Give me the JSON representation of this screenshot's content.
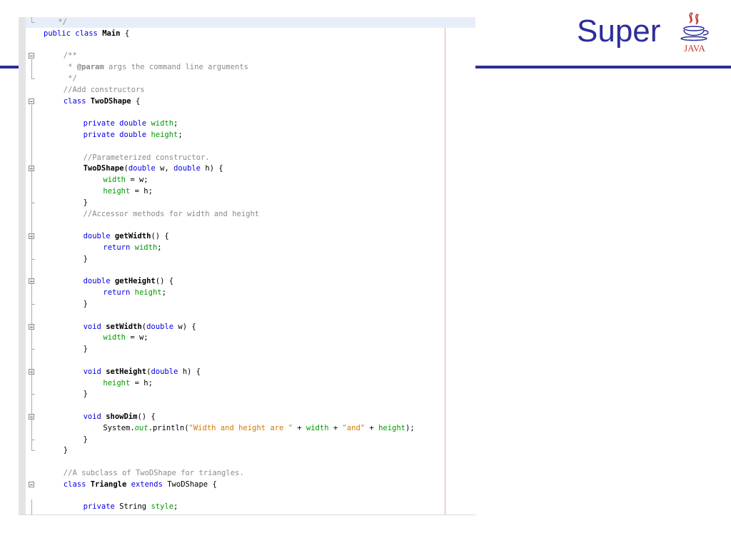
{
  "slide": {
    "title": "Super",
    "logo_text": "JAVA",
    "accent_color": "#2b2e9c"
  },
  "editor": {
    "colors": {
      "keyword": "#0000e6",
      "comment": "#8a8a8a",
      "field": "#009900",
      "string": "#ce7b00"
    },
    "lines": [
      {
        "indent": 2,
        "fold": "corner",
        "highlight": true,
        "tokens": [
          {
            "t": " */",
            "c": "cm"
          }
        ]
      },
      {
        "indent": 0,
        "tokens": [
          {
            "t": "public ",
            "c": "kw"
          },
          {
            "t": "class ",
            "c": "kw"
          },
          {
            "t": "Main",
            "c": "bd"
          },
          {
            "t": " {",
            "c": "pl"
          }
        ]
      },
      {
        "indent": 0,
        "tokens": []
      },
      {
        "indent": 4,
        "fold": "box",
        "tokens": [
          {
            "t": "/**",
            "c": "cm"
          }
        ]
      },
      {
        "indent": 4,
        "tokens": [
          {
            "t": " * ",
            "c": "cm"
          },
          {
            "t": "@param",
            "c": "cmb"
          },
          {
            "t": " args the command line arguments",
            "c": "cm"
          }
        ]
      },
      {
        "indent": 4,
        "fold": "corner",
        "tokens": [
          {
            "t": " */",
            "c": "cm"
          }
        ]
      },
      {
        "indent": 4,
        "tokens": [
          {
            "t": "//Add constructors",
            "c": "cm"
          }
        ]
      },
      {
        "indent": 4,
        "fold": "box",
        "tokens": [
          {
            "t": "class ",
            "c": "kw"
          },
          {
            "t": "TwoDShape",
            "c": "bd"
          },
          {
            "t": " {",
            "c": "pl"
          }
        ]
      },
      {
        "indent": 0,
        "tokens": []
      },
      {
        "indent": 8,
        "tokens": [
          {
            "t": "private ",
            "c": "kw"
          },
          {
            "t": "double ",
            "c": "kw"
          },
          {
            "t": "width",
            "c": "fd"
          },
          {
            "t": ";",
            "c": "pl"
          }
        ]
      },
      {
        "indent": 8,
        "tokens": [
          {
            "t": "private ",
            "c": "kw"
          },
          {
            "t": "double ",
            "c": "kw"
          },
          {
            "t": "height",
            "c": "fd"
          },
          {
            "t": ";",
            "c": "pl"
          }
        ]
      },
      {
        "indent": 0,
        "tokens": []
      },
      {
        "indent": 8,
        "tokens": [
          {
            "t": "//Parameterized constructor.",
            "c": "cm"
          }
        ]
      },
      {
        "indent": 8,
        "fold": "box",
        "tokens": [
          {
            "t": "TwoDShape",
            "c": "bd"
          },
          {
            "t": "(",
            "c": "pl"
          },
          {
            "t": "double",
            "c": "kw"
          },
          {
            "t": " w, ",
            "c": "pl"
          },
          {
            "t": "double",
            "c": "kw"
          },
          {
            "t": " h) {",
            "c": "pl"
          }
        ]
      },
      {
        "indent": 12,
        "tokens": [
          {
            "t": "width",
            "c": "fd"
          },
          {
            "t": " = w;",
            "c": "pl"
          }
        ]
      },
      {
        "indent": 12,
        "tokens": [
          {
            "t": "height",
            "c": "fd"
          },
          {
            "t": " = h;",
            "c": "pl"
          }
        ]
      },
      {
        "indent": 8,
        "fold": "tick",
        "tokens": [
          {
            "t": "}",
            "c": "pl"
          }
        ]
      },
      {
        "indent": 8,
        "tokens": [
          {
            "t": "//Accessor methods for width and height",
            "c": "cm"
          }
        ]
      },
      {
        "indent": 0,
        "tokens": []
      },
      {
        "indent": 8,
        "fold": "box",
        "tokens": [
          {
            "t": "double ",
            "c": "kw"
          },
          {
            "t": "getWidth",
            "c": "bd"
          },
          {
            "t": "() {",
            "c": "pl"
          }
        ]
      },
      {
        "indent": 12,
        "tokens": [
          {
            "t": "return ",
            "c": "kw"
          },
          {
            "t": "width",
            "c": "fd"
          },
          {
            "t": ";",
            "c": "pl"
          }
        ]
      },
      {
        "indent": 8,
        "fold": "tick",
        "tokens": [
          {
            "t": "}",
            "c": "pl"
          }
        ]
      },
      {
        "indent": 0,
        "tokens": []
      },
      {
        "indent": 8,
        "fold": "box",
        "tokens": [
          {
            "t": "double ",
            "c": "kw"
          },
          {
            "t": "getHeight",
            "c": "bd"
          },
          {
            "t": "() {",
            "c": "pl"
          }
        ]
      },
      {
        "indent": 12,
        "tokens": [
          {
            "t": "return ",
            "c": "kw"
          },
          {
            "t": "height",
            "c": "fd"
          },
          {
            "t": ";",
            "c": "pl"
          }
        ]
      },
      {
        "indent": 8,
        "fold": "tick",
        "tokens": [
          {
            "t": "}",
            "c": "pl"
          }
        ]
      },
      {
        "indent": 0,
        "tokens": []
      },
      {
        "indent": 8,
        "fold": "box",
        "tokens": [
          {
            "t": "void ",
            "c": "kw"
          },
          {
            "t": "setWidth",
            "c": "bd"
          },
          {
            "t": "(",
            "c": "pl"
          },
          {
            "t": "double",
            "c": "kw"
          },
          {
            "t": " w) {",
            "c": "pl"
          }
        ]
      },
      {
        "indent": 12,
        "tokens": [
          {
            "t": "width",
            "c": "fd"
          },
          {
            "t": " = w;",
            "c": "pl"
          }
        ]
      },
      {
        "indent": 8,
        "fold": "tick",
        "tokens": [
          {
            "t": "}",
            "c": "pl"
          }
        ]
      },
      {
        "indent": 0,
        "tokens": []
      },
      {
        "indent": 8,
        "fold": "box",
        "tokens": [
          {
            "t": "void ",
            "c": "kw"
          },
          {
            "t": "setHeight",
            "c": "bd"
          },
          {
            "t": "(",
            "c": "pl"
          },
          {
            "t": "double",
            "c": "kw"
          },
          {
            "t": " h) {",
            "c": "pl"
          }
        ]
      },
      {
        "indent": 12,
        "tokens": [
          {
            "t": "height",
            "c": "fd"
          },
          {
            "t": " = h;",
            "c": "pl"
          }
        ]
      },
      {
        "indent": 8,
        "fold": "tick",
        "tokens": [
          {
            "t": "}",
            "c": "pl"
          }
        ]
      },
      {
        "indent": 0,
        "tokens": []
      },
      {
        "indent": 8,
        "fold": "box",
        "tokens": [
          {
            "t": "void ",
            "c": "kw"
          },
          {
            "t": "showDim",
            "c": "bd"
          },
          {
            "t": "() {",
            "c": "pl"
          }
        ]
      },
      {
        "indent": 12,
        "tokens": [
          {
            "t": "System.",
            "c": "pl"
          },
          {
            "t": "out",
            "c": "it"
          },
          {
            "t": ".println(",
            "c": "pl"
          },
          {
            "t": "\"Width and height are \"",
            "c": "st"
          },
          {
            "t": " + ",
            "c": "pl"
          },
          {
            "t": "width",
            "c": "fd"
          },
          {
            "t": " + ",
            "c": "pl"
          },
          {
            "t": "\"and\"",
            "c": "st"
          },
          {
            "t": " + ",
            "c": "pl"
          },
          {
            "t": "height",
            "c": "fd"
          },
          {
            "t": ");",
            "c": "pl"
          }
        ]
      },
      {
        "indent": 8,
        "fold": "tick",
        "tokens": [
          {
            "t": "}",
            "c": "pl"
          }
        ]
      },
      {
        "indent": 4,
        "fold": "corner",
        "tokens": [
          {
            "t": "}",
            "c": "pl"
          }
        ]
      },
      {
        "indent": 0,
        "tokens": []
      },
      {
        "indent": 4,
        "tokens": [
          {
            "t": "//A subclass of TwoDShape for triangles.",
            "c": "cm"
          }
        ]
      },
      {
        "indent": 4,
        "fold": "box",
        "tokens": [
          {
            "t": "class ",
            "c": "kw"
          },
          {
            "t": "Triangle",
            "c": "bd"
          },
          {
            "t": " ",
            "c": "pl"
          },
          {
            "t": "extends",
            "c": "kw"
          },
          {
            "t": " TwoDShape {",
            "c": "pl"
          }
        ]
      },
      {
        "indent": 0,
        "tokens": []
      },
      {
        "indent": 8,
        "tokens": [
          {
            "t": "private ",
            "c": "kw"
          },
          {
            "t": "String ",
            "c": "pl"
          },
          {
            "t": "style",
            "c": "fd"
          },
          {
            "t": ";",
            "c": "pl"
          }
        ]
      }
    ]
  }
}
